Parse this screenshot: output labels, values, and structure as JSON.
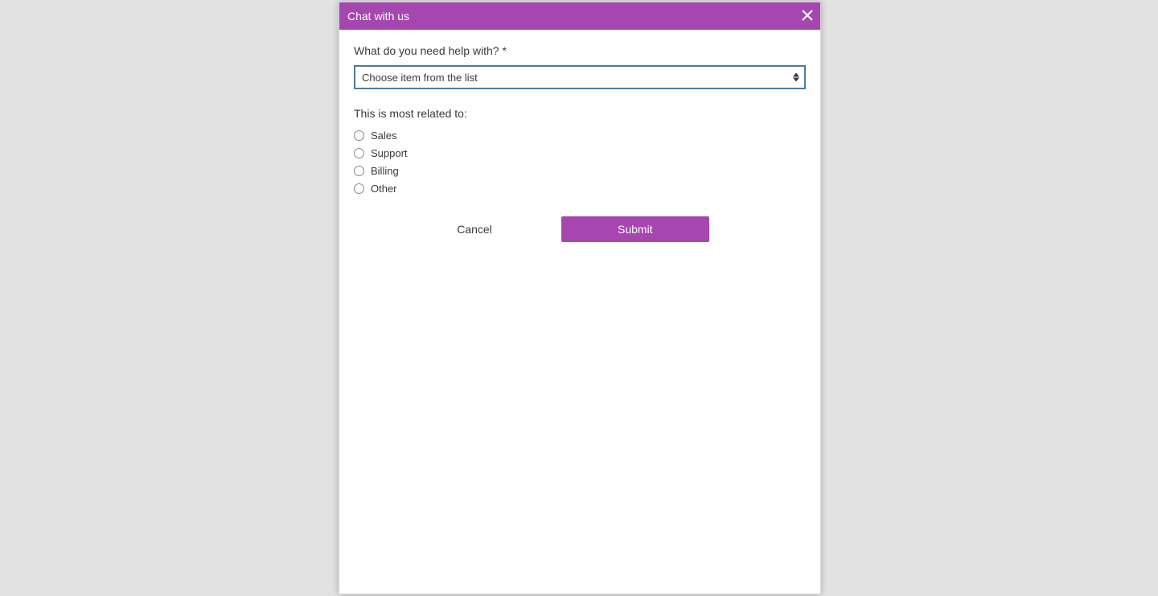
{
  "header": {
    "title": "Chat with us"
  },
  "form": {
    "q1": {
      "label": "What do you need help with? *",
      "placeholder": "Choose item from the list"
    },
    "q2": {
      "label": "This is most related to:",
      "options": [
        "Sales",
        "Support",
        "Billing",
        "Other"
      ]
    },
    "buttons": {
      "cancel": "Cancel",
      "submit": "Submit"
    }
  },
  "colors": {
    "accent": "#a646b0",
    "select_border": "#4a7c9e"
  }
}
